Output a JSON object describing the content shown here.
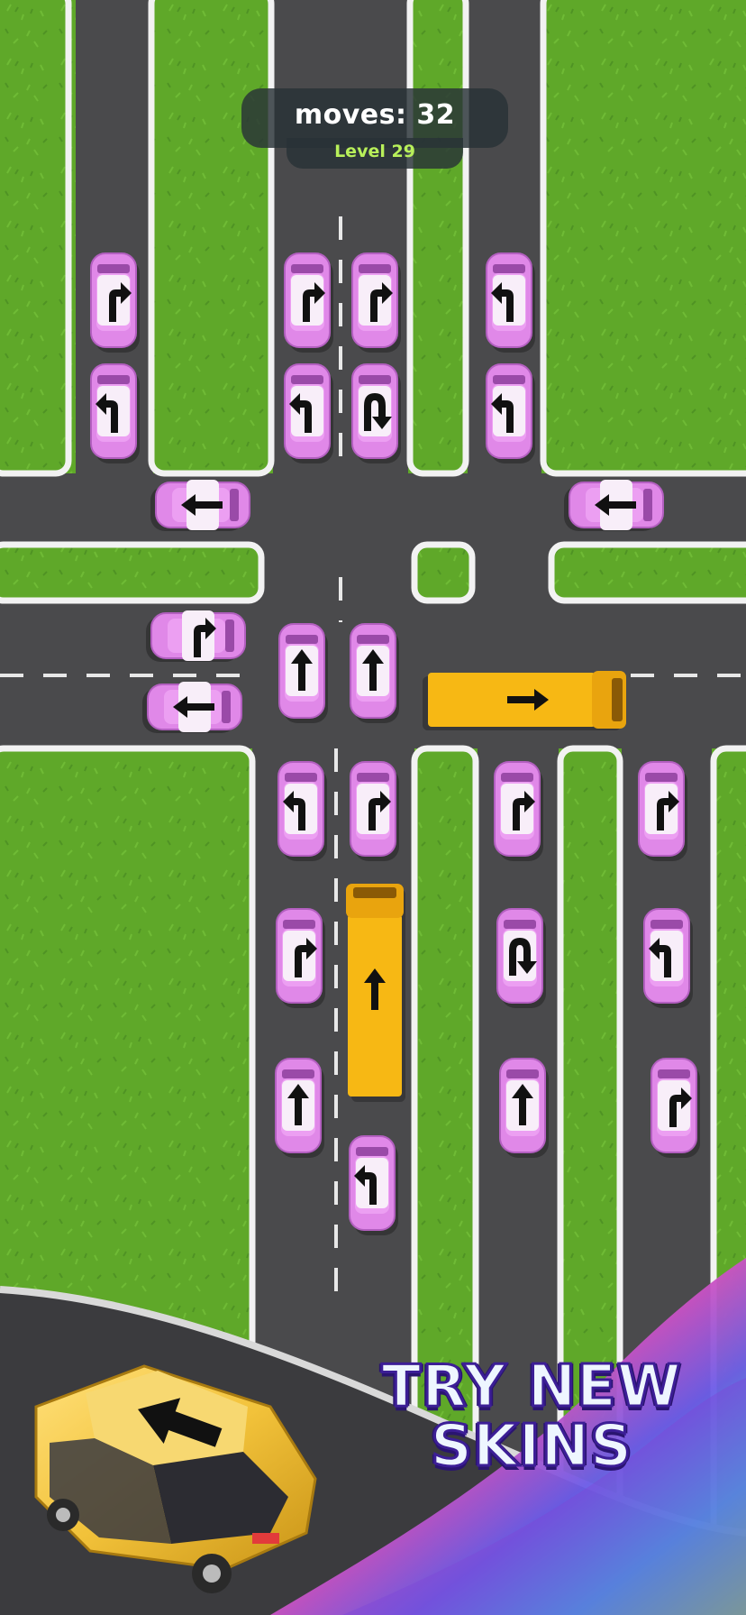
{
  "hud": {
    "moves_text": "moves: 32",
    "level_text": "Level 29"
  },
  "promo": {
    "line1": "TRY NEW",
    "line2": "SKINS"
  },
  "colors": {
    "grass": "#5fa829",
    "road": "#4a4a4c",
    "curb": "#f2f2f2",
    "car_pink": "#e088e8",
    "truck_yellow": "#f7b814",
    "promo_car": "#f2c23a"
  },
  "vehicles": [
    {
      "id": "car-1",
      "kind": "car",
      "color": "pink",
      "arrow": "turn-right"
    },
    {
      "id": "car-2",
      "kind": "car",
      "color": "pink",
      "arrow": "turn-left"
    },
    {
      "id": "car-3",
      "kind": "car",
      "color": "pink",
      "arrow": "turn-right"
    },
    {
      "id": "car-4",
      "kind": "car",
      "color": "pink",
      "arrow": "turn-left"
    },
    {
      "id": "car-5",
      "kind": "car",
      "color": "pink",
      "arrow": "turn-right"
    },
    {
      "id": "car-6",
      "kind": "car",
      "color": "pink",
      "arrow": "u-turn"
    },
    {
      "id": "car-7",
      "kind": "car",
      "color": "pink",
      "arrow": "turn-left"
    },
    {
      "id": "car-8",
      "kind": "car",
      "color": "pink",
      "arrow": "turn-left"
    },
    {
      "id": "car-9",
      "kind": "car",
      "color": "pink",
      "arrow": "left"
    },
    {
      "id": "car-10",
      "kind": "car",
      "color": "pink",
      "arrow": "left"
    },
    {
      "id": "car-11",
      "kind": "car",
      "color": "pink",
      "arrow": "turn-right"
    },
    {
      "id": "car-12",
      "kind": "car",
      "color": "pink",
      "arrow": "left"
    },
    {
      "id": "car-13",
      "kind": "car",
      "color": "pink",
      "arrow": "up"
    },
    {
      "id": "car-14",
      "kind": "car",
      "color": "pink",
      "arrow": "up"
    },
    {
      "id": "truck-1",
      "kind": "truck",
      "color": "yellow",
      "arrow": "right"
    },
    {
      "id": "car-15",
      "kind": "car",
      "color": "pink",
      "arrow": "turn-left"
    },
    {
      "id": "car-16",
      "kind": "car",
      "color": "pink",
      "arrow": "turn-right"
    },
    {
      "id": "car-17",
      "kind": "car",
      "color": "pink",
      "arrow": "turn-right"
    },
    {
      "id": "car-18",
      "kind": "car",
      "color": "pink",
      "arrow": "turn-right"
    },
    {
      "id": "car-19",
      "kind": "car",
      "color": "pink",
      "arrow": "turn-right"
    },
    {
      "id": "truck-2",
      "kind": "truck",
      "color": "yellow",
      "arrow": "up"
    },
    {
      "id": "car-20",
      "kind": "car",
      "color": "pink",
      "arrow": "u-turn"
    },
    {
      "id": "car-21",
      "kind": "car",
      "color": "pink",
      "arrow": "turn-left"
    },
    {
      "id": "car-22",
      "kind": "car",
      "color": "pink",
      "arrow": "up"
    },
    {
      "id": "car-23",
      "kind": "car",
      "color": "pink",
      "arrow": "up"
    },
    {
      "id": "car-24",
      "kind": "car",
      "color": "pink",
      "arrow": "turn-right"
    },
    {
      "id": "car-25",
      "kind": "car",
      "color": "pink",
      "arrow": "turn-left"
    }
  ]
}
